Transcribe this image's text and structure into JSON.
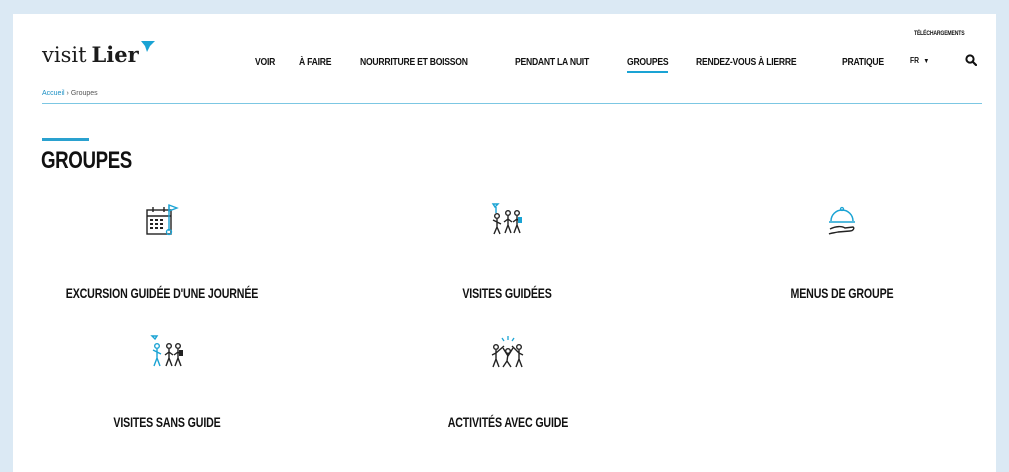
{
  "brand": {
    "word1": "visit",
    "word2": "Lier"
  },
  "header": {
    "downloads": "TÉLÉCHARGEMENTS",
    "nav": [
      {
        "label": "VOIR"
      },
      {
        "label": "À FAIRE"
      },
      {
        "label": "NOURRITURE ET BOISSON"
      },
      {
        "label": "PENDANT LA NUIT"
      },
      {
        "label": "GROUPES"
      },
      {
        "label": "RENDEZ-VOUS À LIERRE"
      },
      {
        "label": "PRATIQUE"
      }
    ],
    "language": "FR",
    "search_icon": "search-icon"
  },
  "breadcrumb": {
    "home": "Accueil",
    "separator": "›",
    "current": "Groupes"
  },
  "page": {
    "title": "GROUPES"
  },
  "tiles": [
    {
      "label": "EXCURSION GUIDÉE D'UNE JOURNÉE",
      "icon": "calendar-flag-icon"
    },
    {
      "label": "VISITES GUIDÉES",
      "icon": "guided-group-icon"
    },
    {
      "label": "MENUS DE GROUPE",
      "icon": "cloche-platter-icon"
    },
    {
      "label": "VISITES SANS GUIDE",
      "icon": "self-guided-group-icon"
    },
    {
      "label": "ACTIVITÉS AVEC GUIDE",
      "icon": "group-activity-icon"
    }
  ],
  "colors": {
    "accent": "#1aa3d4",
    "background": "#dbe9f4",
    "text": "#111111"
  }
}
